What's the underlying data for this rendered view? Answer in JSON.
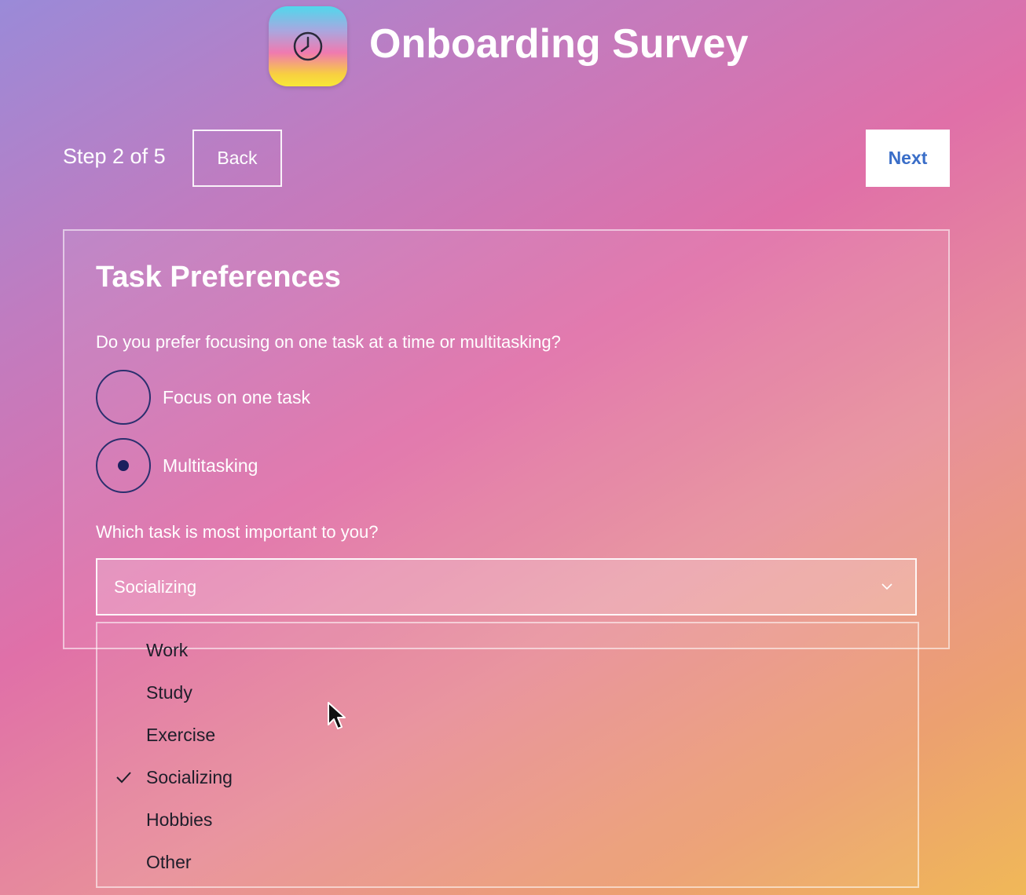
{
  "header": {
    "app_icon": "clock-icon",
    "title": "Onboarding Survey"
  },
  "nav": {
    "step_label": "Step 2 of 5",
    "back_label": "Back",
    "next_label": "Next"
  },
  "card": {
    "title": "Task Preferences",
    "question1": "Do you prefer focusing on one task at a time or multitasking?",
    "radio_options": [
      {
        "label": "Focus on one task",
        "selected": false
      },
      {
        "label": "Multitasking",
        "selected": true
      }
    ],
    "question2": "Which task is most important to you?",
    "select_value": "Socializing"
  },
  "dropdown": {
    "options": [
      {
        "label": "Work",
        "selected": false
      },
      {
        "label": "Study",
        "selected": false
      },
      {
        "label": "Exercise",
        "selected": false
      },
      {
        "label": "Socializing",
        "selected": true
      },
      {
        "label": "Hobbies",
        "selected": false
      },
      {
        "label": "Other",
        "selected": false
      }
    ]
  },
  "colors": {
    "next_text": "#3a6ec8",
    "radio_border": "#2a2f6e",
    "option_text": "#1e1e2a"
  }
}
